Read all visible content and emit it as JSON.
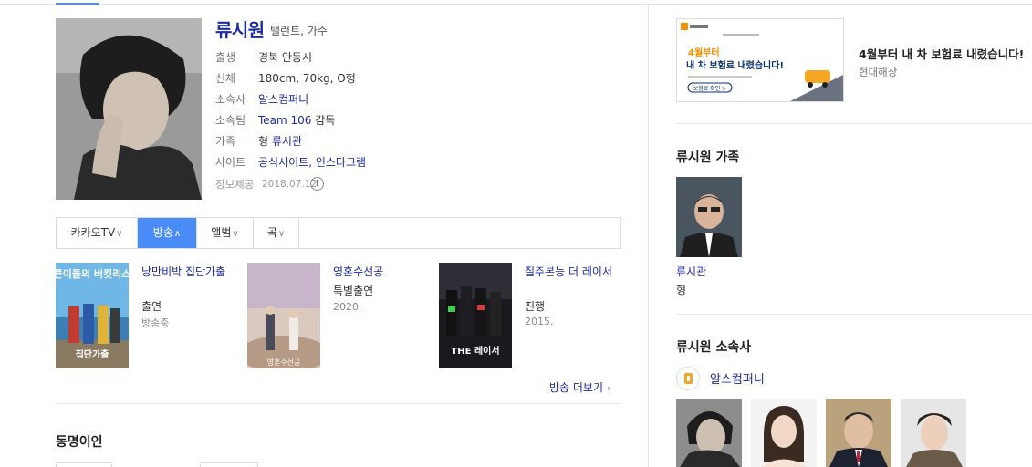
{
  "profile": {
    "name": "류시원",
    "job": "탤런트, 가수",
    "rows": [
      {
        "key": "출생",
        "value": "경북 안동시"
      },
      {
        "key": "신체",
        "value": "180cm, 70kg, O형"
      },
      {
        "key": "소속사",
        "value": "알스컴퍼니"
      },
      {
        "key": "소속팀",
        "value_link": "Team 106",
        "value_rest": " 감독"
      },
      {
        "key": "가족",
        "value_prefix": "형 ",
        "value_link": "류시관"
      },
      {
        "key": "사이트",
        "value": "공식사이트, 인스타그램"
      }
    ],
    "source_key": "정보제공",
    "source_date": "2018.07.12.",
    "info_glyph": "!"
  },
  "tabs": [
    {
      "label": "카카오TV",
      "chevron": "∨",
      "active": false
    },
    {
      "label": "방송",
      "chevron": "∧",
      "active": true
    },
    {
      "label": "앨범",
      "chevron": "∨",
      "active": false
    },
    {
      "label": "곡",
      "chevron": "∨",
      "active": false
    }
  ],
  "broadcasts": [
    {
      "title": "낭만비박 집단가출",
      "role": "출연",
      "meta": "방송중",
      "poster_text": "어른이들의 버킷리스트",
      "poster_sub": "집단가출"
    },
    {
      "title": "영혼수선공",
      "role": "특별출연",
      "meta": "2020.",
      "poster_text": "영혼수선공"
    },
    {
      "title": "질주본능 더 레이서",
      "role": "진행",
      "meta": "2015.",
      "poster_text": "THE 레이서"
    }
  ],
  "more": {
    "label": "방송 더보기",
    "chevron": "›"
  },
  "namesake_heading": "동명이인",
  "ad": {
    "title": "4월부터 내 차 보험료 내렸습니다!",
    "source": "현대해상",
    "img_line1": "4월부터",
    "img_line2": "내 차 보험료 내렸습니다!",
    "img_button": "보험료 확인 >"
  },
  "family": {
    "heading": "류시원 가족",
    "name": "류시관",
    "relation": "형"
  },
  "agency": {
    "heading": "류시원 소속사",
    "name": "알스컴퍼니"
  },
  "colors": {
    "accent": "#4a8cf7",
    "link": "#1c2ba0"
  }
}
